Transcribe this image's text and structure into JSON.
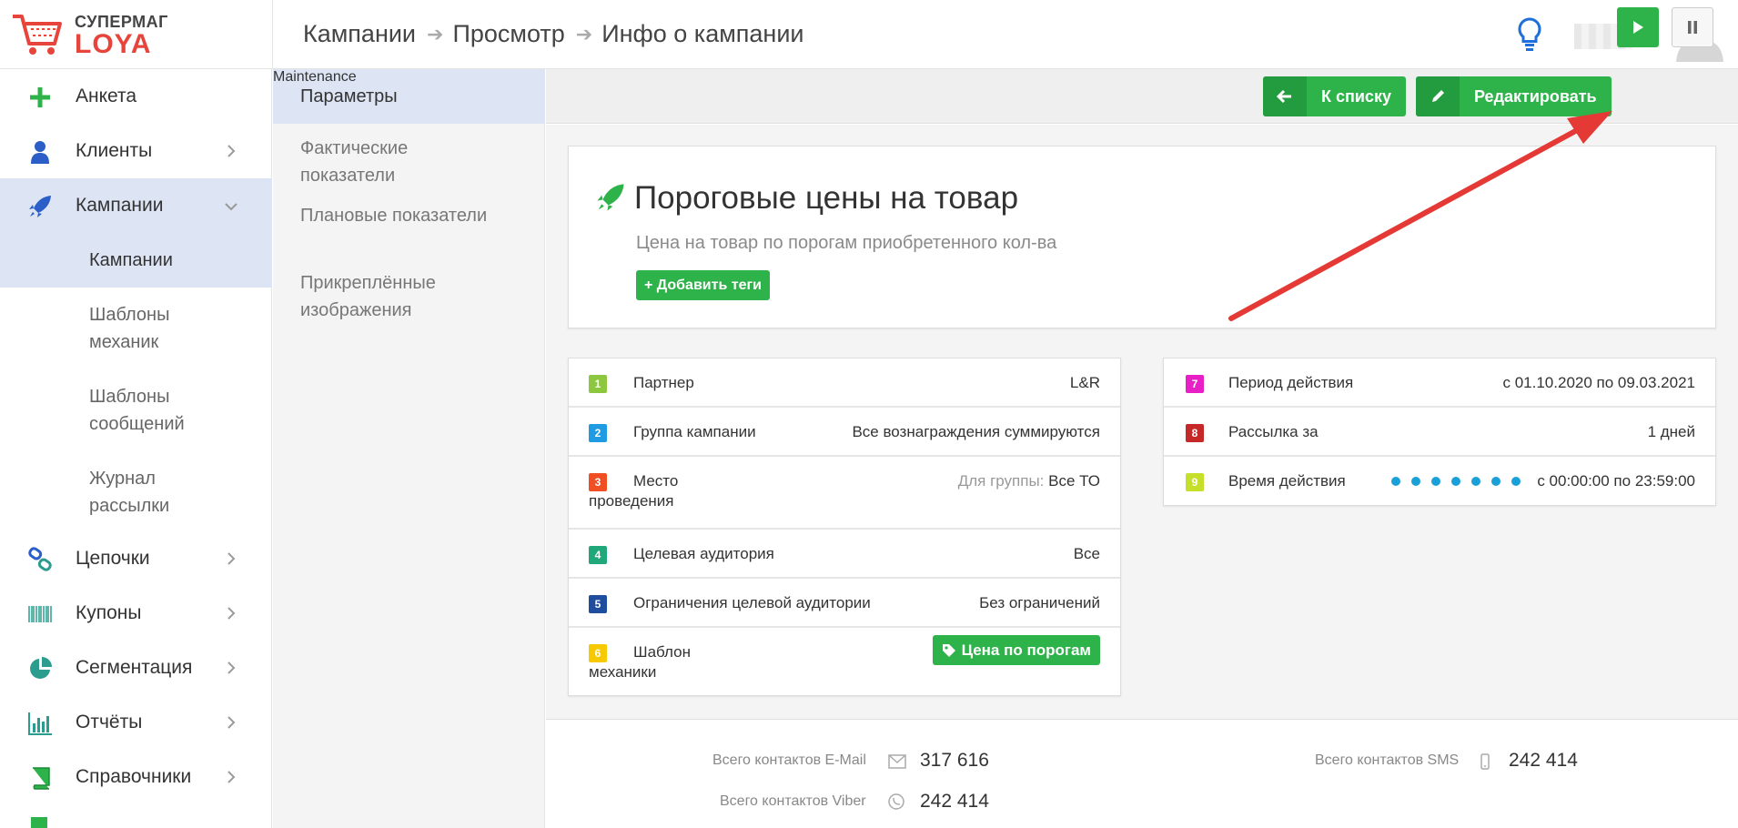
{
  "header": {
    "brand_top": "СУПЕРМАГ",
    "brand_bottom": "LOYA",
    "breadcrumb": [
      "Кампании",
      "Просмотр",
      "Инфо о кампании"
    ]
  },
  "sidebar": {
    "items": [
      {
        "label": "Анкета",
        "icon": "plus-icon"
      },
      {
        "label": "Клиенты",
        "icon": "user-icon"
      },
      {
        "label": "Кампании",
        "icon": "rocket-icon"
      },
      {
        "label": "Цепочки",
        "icon": "chain-icon"
      },
      {
        "label": "Купоны",
        "icon": "barcode-icon"
      },
      {
        "label": "Сегментация",
        "icon": "pie-icon"
      },
      {
        "label": "Отчёты",
        "icon": "bar-chart-icon"
      },
      {
        "label": "Справочники",
        "icon": "book-icon"
      }
    ],
    "sub_items": [
      "Кампании",
      "Шаблоны механик",
      "Шаблоны сообщений",
      "Журнал рассылки"
    ]
  },
  "submenu": {
    "items": [
      "Параметры",
      "Фактические показатели",
      "Плановые показатели",
      "Прикреплённые изображения"
    ]
  },
  "toolbar": {
    "back_label": "К списку",
    "edit_label": "Редактировать"
  },
  "campaign": {
    "title": "Пороговые цены на товар",
    "description": "Цена на товар по порогам приобретенного кол-ва",
    "add_tags_label": "+ Добавить теги"
  },
  "params_left": [
    {
      "num": "1",
      "color": "#8dc63f",
      "label": "Партнер",
      "value": "L&R"
    },
    {
      "num": "2",
      "color": "#1e9be3",
      "label": "Группа кампании",
      "value": "Все вознаграждения суммируются"
    },
    {
      "num": "3",
      "color": "#f04e23",
      "label": "Место проведения",
      "value_prefix": "Для группы:",
      "value": "Все ТО"
    },
    {
      "num": "4",
      "color": "#20a77a",
      "label": "Целевая аудитория",
      "value": "Все"
    },
    {
      "num": "5",
      "color": "#1f4e9e",
      "label": "Ограничения целевой аудитории",
      "value": "Без ограничений"
    },
    {
      "num": "6",
      "color": "#f7c900",
      "label": "Шаблон механики",
      "button": "Цена по порогам"
    }
  ],
  "params_right": [
    {
      "num": "7",
      "color": "#e81ec6",
      "label": "Период действия",
      "value": "с 01.10.2020 по 09.03.2021"
    },
    {
      "num": "8",
      "color": "#c62828",
      "label": "Рассылка за",
      "value": "1 дней"
    },
    {
      "num": "9",
      "color": "#c6df2a",
      "label": "Время действия",
      "value": "с 00:00:00 по 23:59:00",
      "dots": 7
    }
  ],
  "stats": {
    "email_label": "Всего контактов E-Mail",
    "email_value": "317 616",
    "sms_label": "Всего контактов SMS",
    "sms_value": "242 414",
    "viber_label": "Всего контактов Viber",
    "viber_value": "242 414"
  },
  "colors": {
    "green": "#2db34a",
    "active_bg": "#dde4f4",
    "annotation_red": "#e53935"
  }
}
